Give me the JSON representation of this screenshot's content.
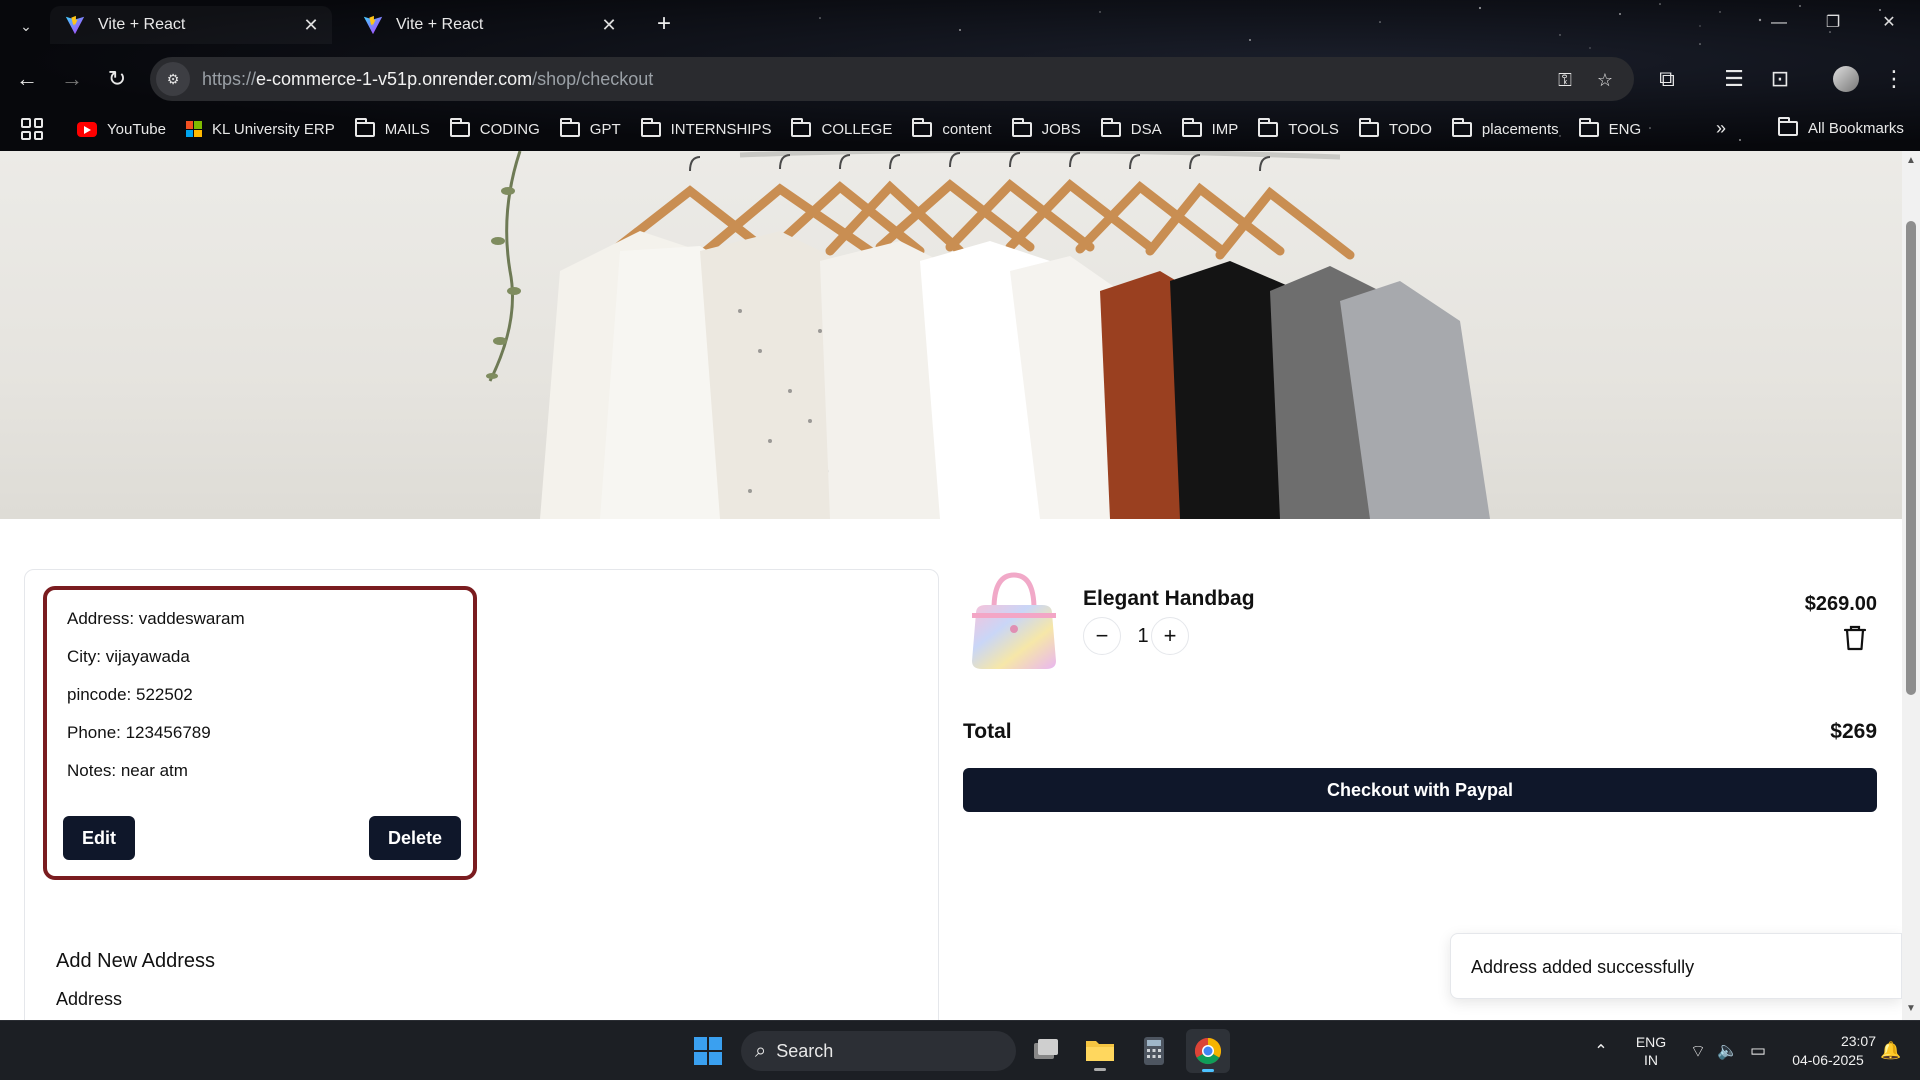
{
  "browser": {
    "tabs": [
      {
        "title": "Vite + React",
        "active": true
      },
      {
        "title": "Vite + React",
        "active": false
      }
    ],
    "url_scheme": "https://",
    "url_host": "e-commerce-1-v51p.onrender.com",
    "url_path": "/shop/checkout",
    "bookmarks": [
      {
        "label": "YouTube",
        "icon": "youtube-icon"
      },
      {
        "label": "KL University ERP",
        "icon": "microsoft-icon"
      },
      {
        "label": "MAILS",
        "icon": "folder-icon"
      },
      {
        "label": "CODING",
        "icon": "folder-icon"
      },
      {
        "label": "GPT",
        "icon": "folder-icon"
      },
      {
        "label": "INTERNSHIPS",
        "icon": "folder-icon"
      },
      {
        "label": "COLLEGE",
        "icon": "folder-icon"
      },
      {
        "label": "content",
        "icon": "folder-icon"
      },
      {
        "label": "JOBS",
        "icon": "folder-icon"
      },
      {
        "label": "DSA",
        "icon": "folder-icon"
      },
      {
        "label": "IMP",
        "icon": "folder-icon"
      },
      {
        "label": "TOOLS",
        "icon": "folder-icon"
      },
      {
        "label": "TODO",
        "icon": "folder-icon"
      },
      {
        "label": "placements",
        "icon": "folder-icon"
      },
      {
        "label": "ENG",
        "icon": "folder-icon"
      }
    ],
    "all_bookmarks_label": "All Bookmarks"
  },
  "address_card": {
    "address": "Address: vaddeswaram",
    "city": "City: vijayawada",
    "pincode": "pincode: 522502",
    "phone": "Phone: 123456789",
    "notes": "Notes: near atm",
    "edit_label": "Edit",
    "delete_label": "Delete"
  },
  "add_address": {
    "title": "Add New Address",
    "address_label": "Address"
  },
  "cart": {
    "item": {
      "name": "Elegant Handbag",
      "quantity": "1",
      "price": "$269.00",
      "minus": "−",
      "plus": "+"
    },
    "total_label": "Total",
    "total_value": "$269",
    "checkout_label": "Checkout with Paypal"
  },
  "toast": {
    "message": "Address added successfully"
  },
  "taskbar": {
    "search_label": "Search",
    "lang_line1": "ENG",
    "lang_line2": "IN",
    "time": "23:07",
    "date": "04-06-2025"
  },
  "colors": {
    "primary_dark": "#0f172a",
    "card_border": "#7a1c1f"
  }
}
